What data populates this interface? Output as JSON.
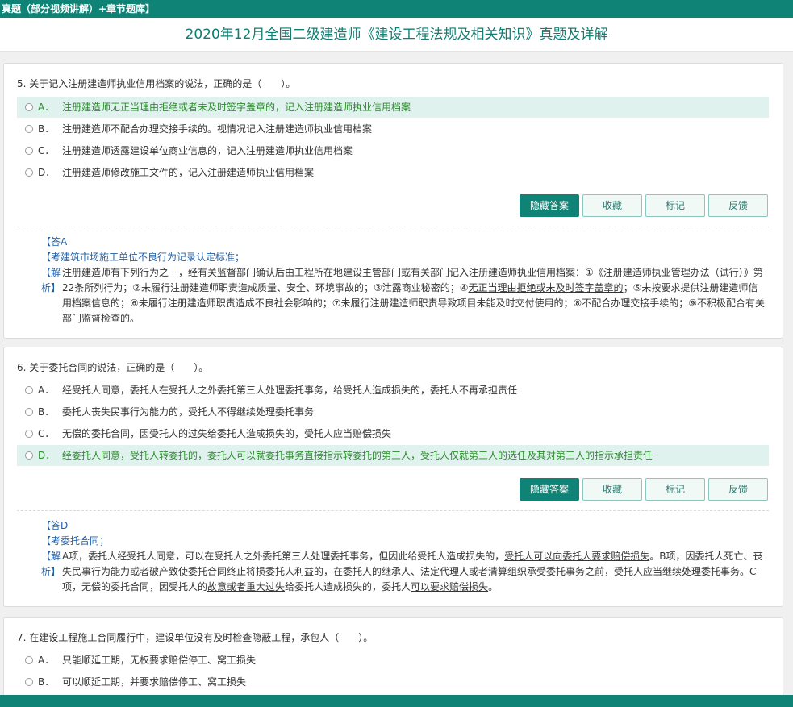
{
  "topbar": {
    "text": "真题（部分视频讲解）+章节题库】"
  },
  "page_title": "2020年12月全国二级建造师《建设工程法规及相关知识》真题及详解",
  "buttons": {
    "hide": "隐藏答案",
    "collect": "收藏",
    "mark": "标记",
    "feedback": "反馈"
  },
  "q5": {
    "stem": "5. 关于记入注册建造师执业信用档案的说法，正确的是（　　）。",
    "options": [
      {
        "letter": "A．",
        "text": "注册建造师无正当理由拒绝或者未及时签字盖章的，记入注册建造师执业信用档案"
      },
      {
        "letter": "B．",
        "text": "注册建造师不配合办理交接手续的。视情况记入注册建造师执业信用档案"
      },
      {
        "letter": "C．",
        "text": "注册建造师透露建设单位商业信息的，记入注册建造师执业信用档案"
      },
      {
        "letter": "D．",
        "text": "注册建造师修改施工文件的，记入注册建造师执业信用档案"
      }
    ],
    "answer": "【答A",
    "point": "【考建筑市场施工单位不良行为记录认定标准；",
    "tag1": "【解",
    "tag2": "析】",
    "exp_line1": "注册建造师有下列行为之一，经有关监督部门确认后由工程所在地建设主管部门或有关部门记入注册建造师执业信用档案：①《注册建造师执业管理办法（试行）》第22条所列行为；②未履行注册建造师职责造成质量、安全、环境事故的；③泄露商业秘密的；④",
    "exp_u1": "无正当理由拒绝或未及时签字盖章的",
    "exp_line2": "；⑤未按要求提供注册建造师信用档案信息的；⑥未履行注册建造师职责造成不良社会影响的；⑦未履行注册建造师职责导致项目未能及时交付使用的；⑧不配合办理交接手续的；⑨不积极配合有关部门监督检查的。"
  },
  "q6": {
    "stem": "6. 关于委托合同的说法，正确的是（　　）。",
    "options": [
      {
        "letter": "A．",
        "text": "经受托人同意，委托人在受托人之外委托第三人处理委托事务，给受托人造成损失的，委托人不再承担责任"
      },
      {
        "letter": "B．",
        "text": "委托人丧失民事行为能力的，受托人不得继续处理委托事务"
      },
      {
        "letter": "C．",
        "text": "无偿的委托合同，因受托人的过失给委托人造成损失的，受托人应当赔偿损失"
      },
      {
        "letter": "D．",
        "text": "经委托人同意，受托人转委托的，委托人可以就委托事务直接指示转委托的第三人，受托人仅就第三人的选任及其对第三人的指示承担责任"
      }
    ],
    "answer": "【答D",
    "point": "【考委托合同；",
    "tag1": "【解",
    "tag2": "析】",
    "e1": "A项，委托人经受托人同意，可以在受托人之外委托第三人处理委托事务，但因此给受托人造成损失的，",
    "e1u": "受托人可以向委托人要求赔偿损失",
    "e2": "。B项，因委托人死亡、丧失民事行为能力或者破产致使委托合同终止将损委托人利益的，在委托人的继承人、法定代理人或者清算组织承受委托事务之前，受托人",
    "e2u": "应当继续处理委托事务",
    "e3": "。C项，无偿的委托合同，因受托人的",
    "e3u": "故意或者重大过失",
    "e4": "给委托人造成损失的，委托人",
    "e4u": "可以要求赔偿损失",
    "e5": "。"
  },
  "q7": {
    "stem": "7. 在建设工程施工合同履行中，建设单位没有及时检查隐蔽工程，承包人（　　）。",
    "options": [
      {
        "letter": "A．",
        "text": "只能顺延工期，无权要求赔偿停工、窝工损失"
      },
      {
        "letter": "B．",
        "text": "可以顺延工期，并要求赔偿停工、窝工损失"
      }
    ]
  }
}
